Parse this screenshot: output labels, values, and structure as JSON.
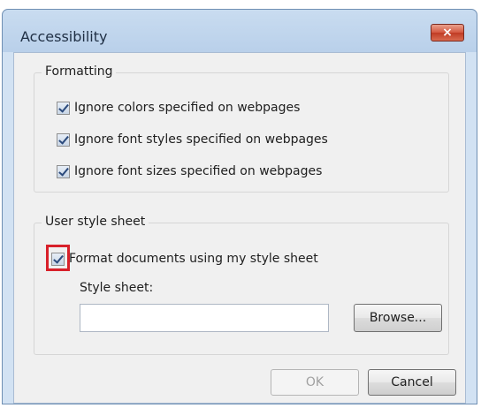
{
  "dialog": {
    "title": "Accessibility",
    "close_symbol": "×"
  },
  "formatting": {
    "label": "Formatting",
    "options": [
      {
        "label": "Ignore colors specified on webpages",
        "checked": true
      },
      {
        "label": "Ignore font styles specified on webpages",
        "checked": true
      },
      {
        "label": "Ignore font sizes specified on webpages",
        "checked": true
      }
    ]
  },
  "user_style_sheet": {
    "label": "User style sheet",
    "format_option": {
      "label": "Format documents using my style sheet",
      "checked": true
    },
    "sheet_label": "Style sheet:",
    "sheet_value": "",
    "browse_label": "Browse..."
  },
  "buttons": {
    "ok_label": "OK",
    "cancel_label": "Cancel"
  },
  "colors": {
    "highlight": "#d8202a",
    "close_button": "#d4573f"
  },
  "icons": [
    "close-icon",
    "checkbox-checked"
  ]
}
